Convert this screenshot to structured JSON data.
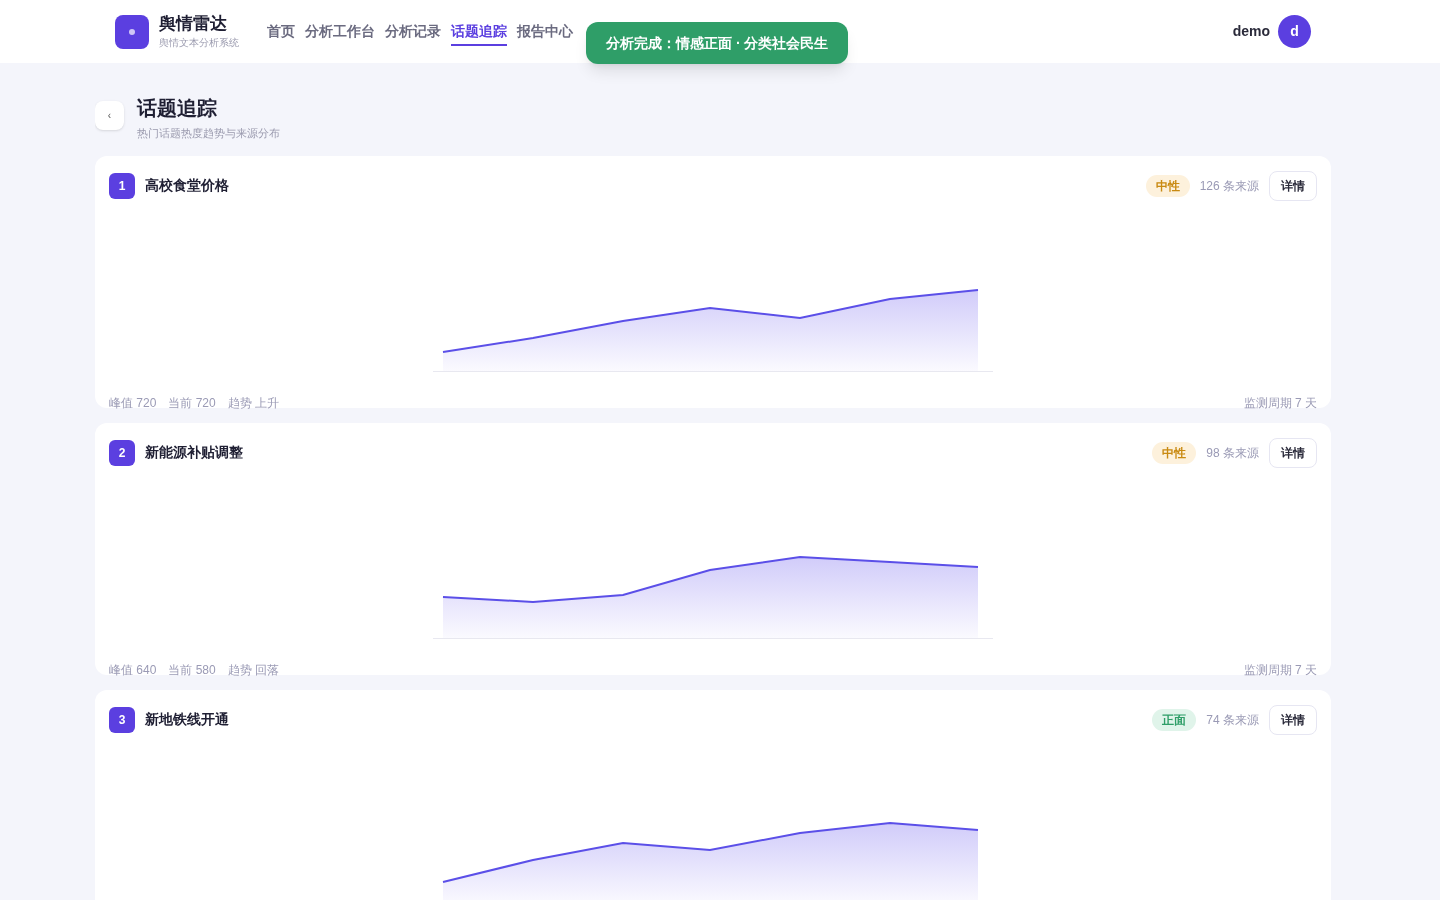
{
  "brand": {
    "name": "舆情雷达",
    "subtitle": "舆情文本分析系统"
  },
  "nav": [
    {
      "label": "首页",
      "selected": false
    },
    {
      "label": "分析工作台",
      "selected": false
    },
    {
      "label": "分析记录",
      "selected": false
    },
    {
      "label": "话题追踪",
      "selected": true
    },
    {
      "label": "报告中心",
      "selected": false
    }
  ],
  "toast": "分析完成：情感正面 · 分类社会民生",
  "user": {
    "name": "demo",
    "avatar": "d"
  },
  "page": {
    "back": "‹",
    "title": "话题追踪",
    "subtitle": "热门话题热度趋势与来源分布"
  },
  "topics": [
    {
      "rank": "1",
      "title": "高校食堂价格",
      "sentiment": "中性",
      "kind": "neutral",
      "sources": "126 条来源",
      "detail": "详情",
      "peak": "峰值 720",
      "current": "当前 720",
      "trend": "趋势 上升",
      "period": "监测周期 7 天"
    },
    {
      "rank": "2",
      "title": "新能源补贴调整",
      "sentiment": "中性",
      "kind": "neutral",
      "sources": "98 条来源",
      "detail": "详情",
      "peak": "峰值 640",
      "current": "当前 580",
      "trend": "趋势 回落",
      "period": "监测周期 7 天"
    },
    {
      "rank": "3",
      "title": "新地铁线开通",
      "sentiment": "正面",
      "kind": "positive",
      "sources": "74 条来源",
      "detail": "详情"
    }
  ]
}
